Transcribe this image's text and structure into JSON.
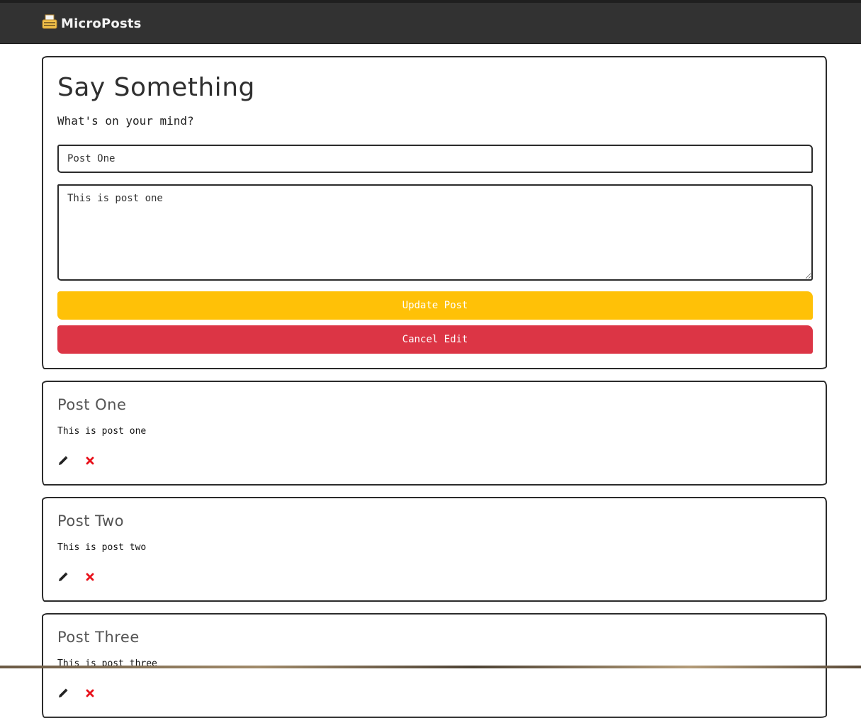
{
  "navbar": {
    "brand": "MicroPosts",
    "brand_icon": "typewriter-icon"
  },
  "form": {
    "title": "Say Something",
    "subtitle": "What's on your mind?",
    "title_value": "Post One",
    "body_value": "This is post one",
    "update_label": "Update Post",
    "cancel_label": "Cancel Edit"
  },
  "posts": [
    {
      "title": "Post One",
      "body": "This is post one",
      "edit_icon": "pencil-icon",
      "delete_icon": "delete-x-icon"
    },
    {
      "title": "Post Two",
      "body": "This is post two",
      "edit_icon": "pencil-icon",
      "delete_icon": "delete-x-icon"
    },
    {
      "title": "Post Three",
      "body": "This is post three",
      "edit_icon": "pencil-icon",
      "delete_icon": "delete-x-icon"
    }
  ],
  "colors": {
    "navbar_bg": "#323232",
    "update_button": "#ffc107",
    "cancel_button": "#dc3545",
    "delete_icon": "#e8101a"
  }
}
